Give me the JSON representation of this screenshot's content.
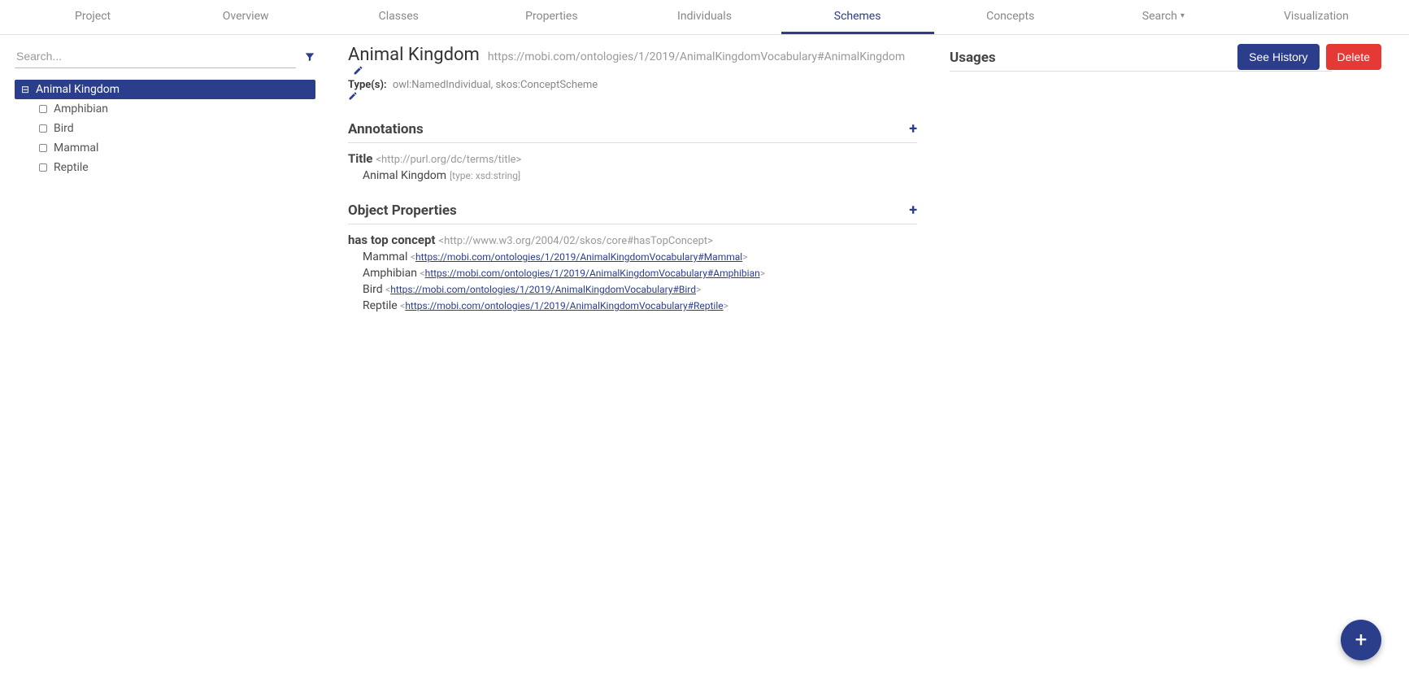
{
  "nav": {
    "items": [
      "Project",
      "Overview",
      "Classes",
      "Properties",
      "Individuals",
      "Schemes",
      "Concepts",
      "Search",
      "Visualization"
    ],
    "active": "Schemes",
    "search_has_caret": true
  },
  "sidebar": {
    "search_placeholder": "Search...",
    "tree": {
      "root": {
        "label": "Animal Kingdom",
        "expanded": true,
        "selected": true
      },
      "children": [
        {
          "label": "Amphibian"
        },
        {
          "label": "Bird"
        },
        {
          "label": "Mammal"
        },
        {
          "label": "Reptile"
        }
      ]
    }
  },
  "entity": {
    "title": "Animal Kingdom",
    "uri": "https://mobi.com/ontologies/1/2019/AnimalKingdomVocabulary#AnimalKingdom",
    "types_label": "Type(s):",
    "types_value": "owl:NamedIndividual, skos:ConceptScheme"
  },
  "annotations": {
    "heading": "Annotations",
    "props": [
      {
        "label": "Title",
        "uri": "<http://purl.org/dc/terms/title>",
        "values": [
          {
            "text": "Animal Kingdom",
            "type": "[type: xsd:string]"
          }
        ]
      }
    ]
  },
  "object_properties": {
    "heading": "Object Properties",
    "props": [
      {
        "label": "has top concept",
        "uri": "<http://www.w3.org/2004/02/skos/core#hasTopConcept>",
        "values": [
          {
            "text": "Mammal",
            "link": "https://mobi.com/ontologies/1/2019/AnimalKingdomVocabulary#Mammal"
          },
          {
            "text": "Amphibian",
            "link": "https://mobi.com/ontologies/1/2019/AnimalKingdomVocabulary#Amphibian"
          },
          {
            "text": "Bird",
            "link": "https://mobi.com/ontologies/1/2019/AnimalKingdomVocabulary#Bird"
          },
          {
            "text": "Reptile",
            "link": "https://mobi.com/ontologies/1/2019/AnimalKingdomVocabulary#Reptile"
          }
        ]
      }
    ]
  },
  "usages": {
    "heading": "Usages"
  },
  "buttons": {
    "see_history": "See History",
    "delete": "Delete"
  }
}
